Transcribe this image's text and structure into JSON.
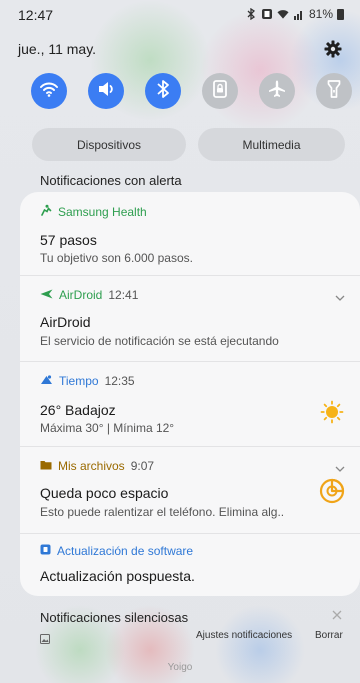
{
  "status_bar": {
    "time": "12:47",
    "battery": "81%",
    "icons": [
      "bluetooth-icon",
      "nfc-icon",
      "wifi-icon",
      "signal-icon",
      "battery-icon"
    ]
  },
  "header": {
    "date": "jue., 11 may."
  },
  "quick_toggles": [
    {
      "name": "wifi",
      "state": "on"
    },
    {
      "name": "sound",
      "state": "on"
    },
    {
      "name": "bluetooth",
      "state": "on"
    },
    {
      "name": "autorotate-lock",
      "state": "off"
    },
    {
      "name": "airplane",
      "state": "off"
    },
    {
      "name": "flashlight",
      "state": "off"
    }
  ],
  "media_buttons": {
    "devices": "Dispositivos",
    "media": "Multimedia"
  },
  "alert_section": {
    "title": "Notificaciones con alerta"
  },
  "notifications": [
    {
      "app": "Samsung Health",
      "time": "",
      "title": "57 pasos",
      "body": "Tu objetivo son 6.000 pasos.",
      "app_color": "#2e9e4f"
    },
    {
      "app": "AirDroid",
      "time": "12:41",
      "title": "AirDroid",
      "body": "El servicio de notificación se está ejecutando",
      "app_color": "#2e9e4f"
    },
    {
      "app": "Tiempo",
      "time": "12:35",
      "title": "26° Badajoz",
      "body": "Máxima 30° | Mínima 12°",
      "app_color": "#2f78d6"
    },
    {
      "app": "Mis archivos",
      "time": "9:07",
      "title": "Queda poco espacio",
      "body": "Esto puede ralentizar el teléfono. Elimina alg..",
      "app_color": "#9a6a00"
    },
    {
      "app": "Actualización de software",
      "time": "",
      "title": "Actualización pospuesta.",
      "body": "",
      "app_color": "#2f78d6"
    }
  ],
  "silent_section": {
    "title": "Notificaciones silenciosas",
    "settings_button": "Ajustes notificaciones",
    "clear_button": "Borrar"
  },
  "carrier": "Yoigo",
  "colors": {
    "toggle_on": "#3b7df3",
    "toggle_off": "#bfc2c6",
    "card_bg": "#f7f7f8"
  }
}
